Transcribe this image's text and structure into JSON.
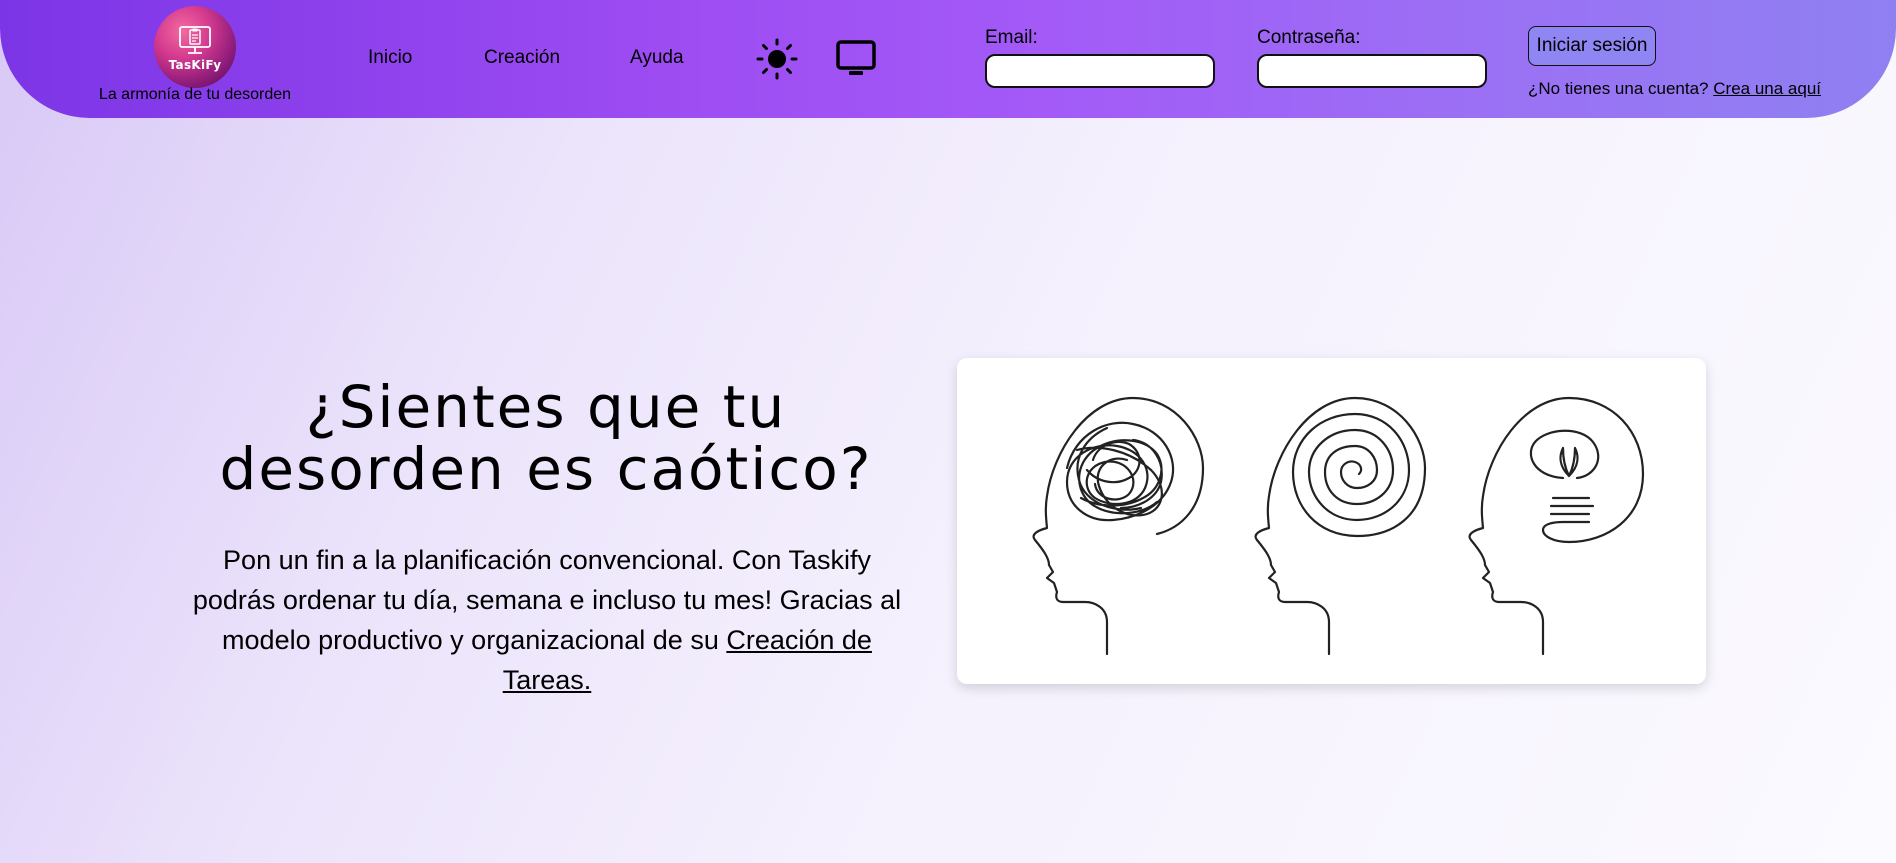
{
  "header": {
    "logo_text": "TasKiFy",
    "tagline": "La armonía de tu desorden",
    "nav": [
      {
        "label": "Inicio"
      },
      {
        "label": "Creación"
      },
      {
        "label": "Ayuda"
      }
    ],
    "theme_icons": [
      "sun-icon",
      "monitor-icon"
    ],
    "login": {
      "email_label": "Email:",
      "email_value": "",
      "password_label": "Contraseña:",
      "password_value": "",
      "submit_label": "Iniciar sesión",
      "signup_prompt": "¿No tienes una cuenta?",
      "signup_link": "Crea una aquí"
    }
  },
  "hero": {
    "title": "¿Sientes que tu desorden es caótico?",
    "text": "Pon un fin a la planificación convencional. Con Taskify podrás ordenar tu día, semana e incluso tu mes! Gracias al modelo productivo y organizacional de su ",
    "link": "Creación de Tareas."
  },
  "colors": {
    "header_start": "#7c35e6",
    "header_end": "#8f80f2",
    "login_button": "#8f86f3",
    "logo_gradient": "#d43a8e"
  },
  "illustration": {
    "icons": [
      "tangled-head-icon",
      "spiral-head-icon",
      "organized-head-icon"
    ]
  }
}
